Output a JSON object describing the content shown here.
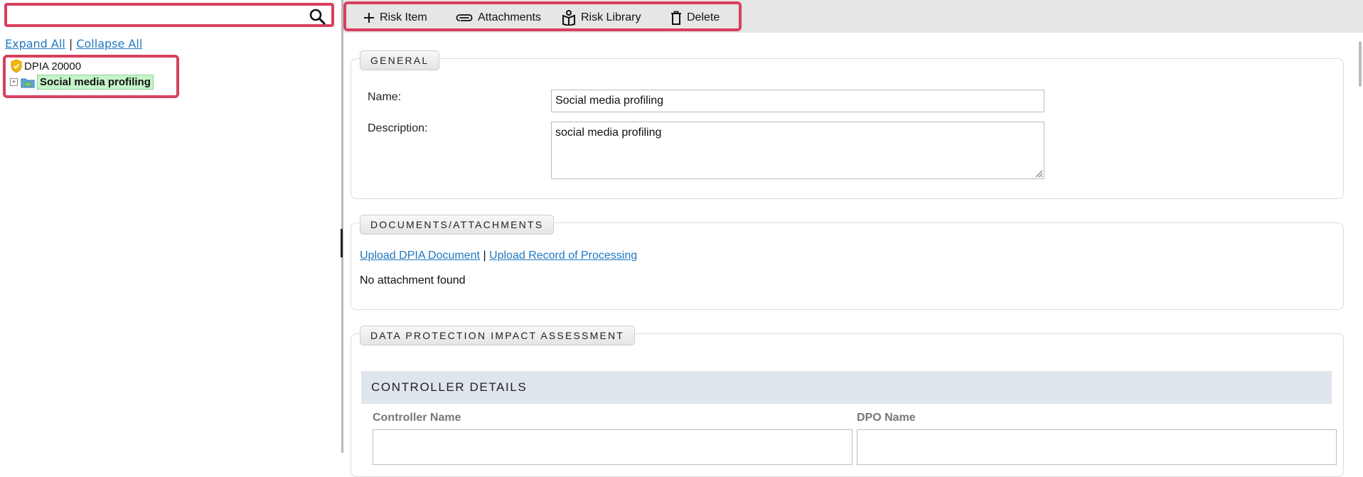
{
  "search": {
    "value": "",
    "placeholder": ""
  },
  "tree": {
    "expand_all": "Expand All",
    "separator": "|",
    "collapse_all": "Collapse All",
    "root_label": "DPIA 20000",
    "child_label": "Social media profiling",
    "expander_symbol": "+"
  },
  "toolbar": {
    "risk_item": "Risk Item",
    "attachments": "Attachments",
    "risk_library": "Risk Library",
    "delete": "Delete"
  },
  "general": {
    "legend": "GENERAL",
    "name_label": "Name:",
    "name_value": "Social media profiling",
    "description_label": "Description:",
    "description_value": "social media profiling"
  },
  "documents": {
    "legend": "DOCUMENTS/ATTACHMENTS",
    "upload_dpia": "Upload DPIA Document",
    "separator": "|",
    "upload_record": "Upload Record of Processing",
    "empty_text": "No attachment found"
  },
  "dpia": {
    "legend": "DATA PROTECTION IMPACT ASSESSMENT",
    "controller_header": "CONTROLLER DETAILS",
    "controller_name_label": "Controller Name",
    "controller_name_value": "",
    "dpo_name_label": "DPO Name",
    "dpo_name_value": ""
  },
  "colors": {
    "highlight_border": "#d8405e",
    "selected_node_bg": "#c5f5c9",
    "link": "#1f78c0",
    "toolbar_bg": "#e6e6e6",
    "section_band": "#dfe5ec"
  },
  "icons": [
    "search-icon",
    "shield-icon",
    "folder-icon",
    "plus-icon",
    "paperclip-icon",
    "book-icon",
    "trash-icon",
    "resize-icon"
  ]
}
